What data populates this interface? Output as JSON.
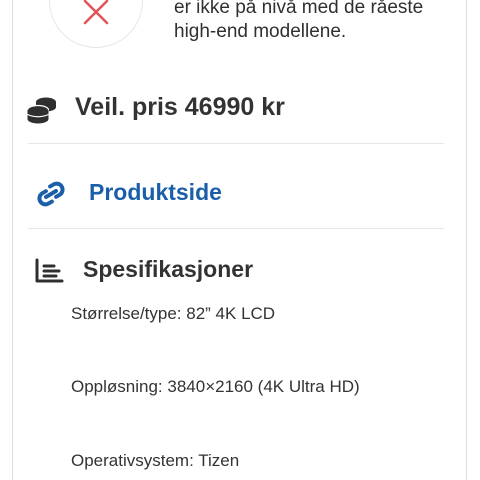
{
  "cons": {
    "icon": "x-icon",
    "lines": [
      "er ikke på nivå med de råeste",
      "high-end modellene."
    ]
  },
  "price": {
    "icon": "coins-stack-icon",
    "label": "Veil. pris 46990 kr"
  },
  "product_link": {
    "icon": "link-icon",
    "label": "Produktside",
    "color": "#1b5fa8"
  },
  "specs": {
    "icon": "list-chart-icon",
    "title": "Spesifikasjoner",
    "items": [
      "Størrelse/type: 82” 4K LCD",
      "Oppløsning: 3840×2160 (4K Ultra HD)",
      "Operativsystem: Tizen"
    ]
  },
  "colors": {
    "x_icon": "#e2545a",
    "accent_link": "#1b5fa8",
    "text": "#333333",
    "divider": "#e7e7e7"
  }
}
